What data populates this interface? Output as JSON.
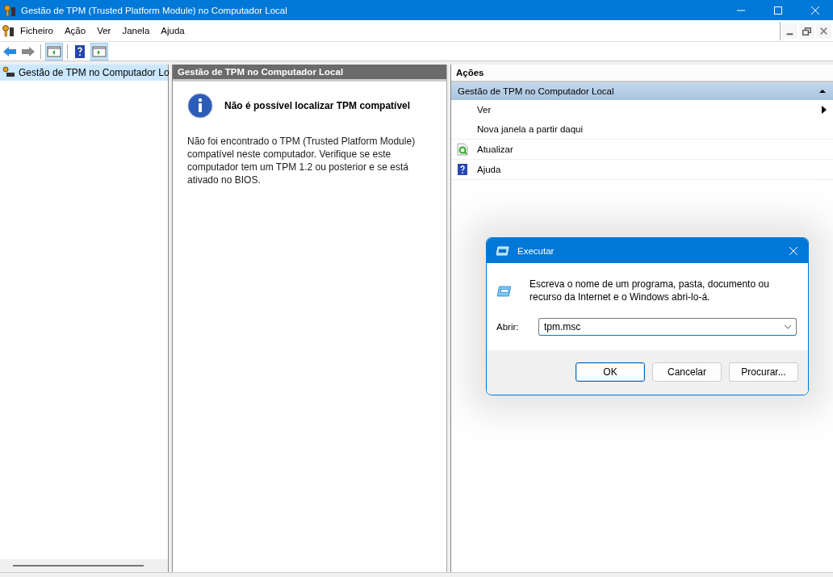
{
  "window": {
    "title": "Gestão de TPM (Trusted Platform Module) no Computador Local"
  },
  "menu": [
    "Ficheiro",
    "Ação",
    "Ver",
    "Janela",
    "Ajuda"
  ],
  "tree": {
    "items": [
      {
        "label": "Gestão de TPM no Computador Lo",
        "selected": true
      }
    ]
  },
  "content": {
    "header": "Gestão de TPM no Computador Local",
    "heading": "Não é possível localizar TPM compatível",
    "message": "Não foi encontrado o TPM (Trusted Platform Module) compatível neste computador. Verifique se este computador tem um TPM 1.2 ou posterior e se está ativado no BIOS."
  },
  "actions": {
    "header": "Ações",
    "group": {
      "label": "Gestão de TPM no Computador Local",
      "expanded": true
    },
    "items": [
      {
        "label": "Ver",
        "kind": "submenu"
      },
      {
        "label": "Nova janela a partir daqui",
        "kind": "plain"
      },
      {
        "label": "Atualizar",
        "kind": "refresh"
      },
      {
        "label": "Ajuda",
        "kind": "help"
      }
    ]
  },
  "run_dialog": {
    "title": "Executar",
    "description": "Escreva o nome de um programa, pasta, documento ou recurso da Internet e o Windows abri-lo-á.",
    "open_label": "Abrir:",
    "value": "tpm.msc",
    "buttons": [
      {
        "label": "OK",
        "default": true
      },
      {
        "label": "Cancelar",
        "default": false
      },
      {
        "label": "Procurar...",
        "default": false
      }
    ]
  }
}
